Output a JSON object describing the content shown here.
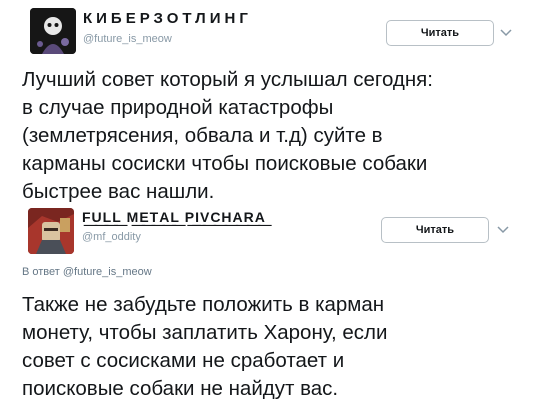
{
  "tweets": [
    {
      "display_name": "КИБЕРЗОТЛИНГ",
      "handle": "@future_is_meow",
      "follow_label": "Читать",
      "text": "Лучший совет который я услышал сегодня:\nв случае природной катастрофы\n(землетрясения, обвала и т.д) суйте в\nкарманы сосиски чтобы поисковые собаки\nбыстрее вас нашли."
    },
    {
      "display_name": "F͟U͟L͟L͟ M͟E͟T͟A͟L͟ P͟I͟V͟C͟H͟A͟R͟A͟",
      "handle": "@mf_oddity",
      "follow_label": "Читать",
      "reply_to": "В ответ @future_is_meow",
      "text": "Также не забудьте положить в карман\nмонету, чтобы заплатить Харону, если\nсовет с сосисками не сработает и\nпоисковые собаки не найдут вас."
    }
  ]
}
